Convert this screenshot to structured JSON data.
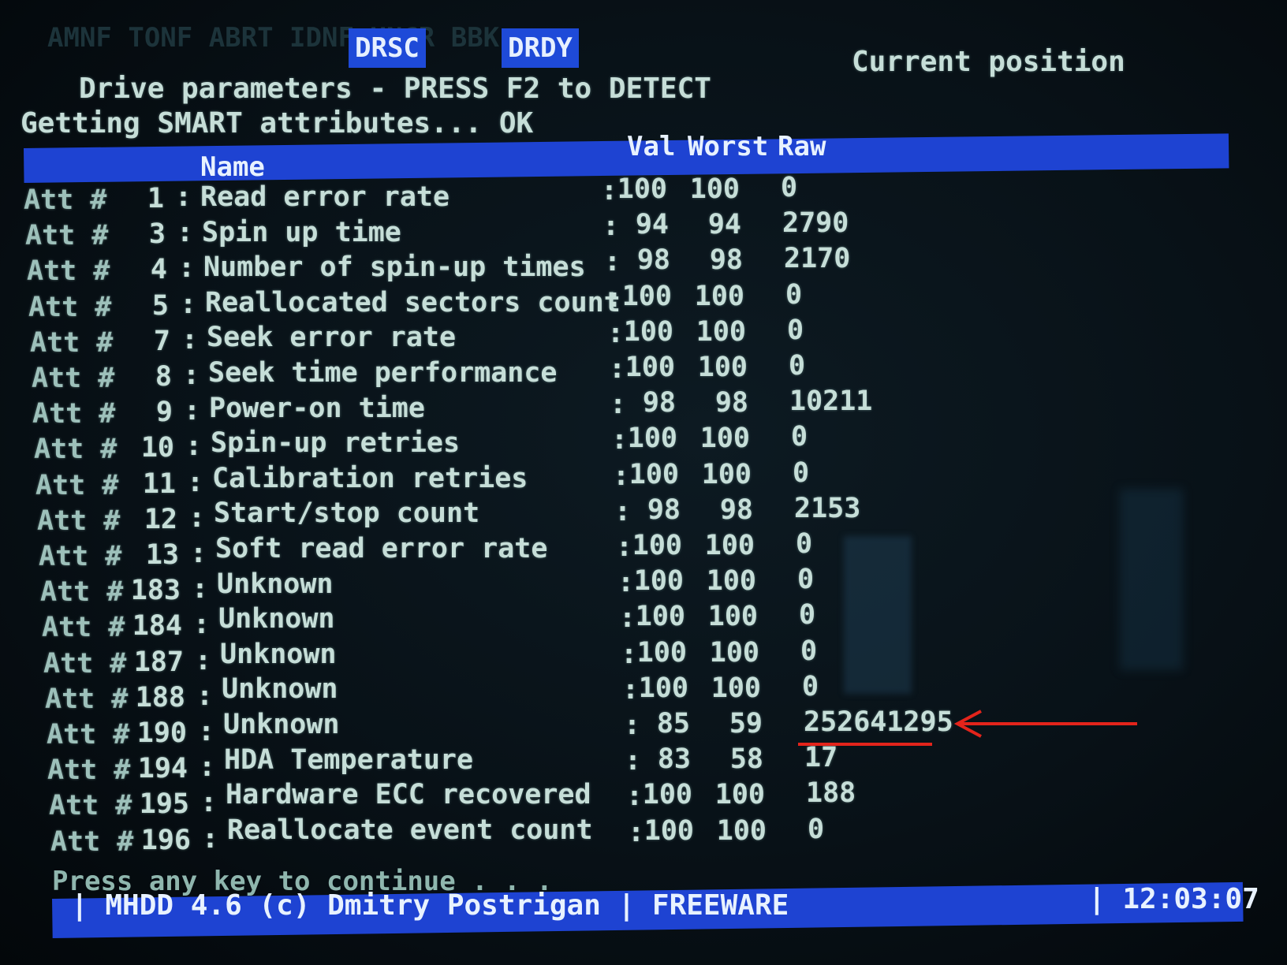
{
  "status_flags_top": "AMNF TONF ABRT IDNF UNCR BBK",
  "status_flags": [
    "DRSC",
    "DRDY"
  ],
  "current_position_label": "Current position",
  "drive_params_line": "Drive parameters - PRESS F2 to DETECT",
  "getting_smart_line": "Getting SMART attributes... OK",
  "table_header": {
    "name": "Name",
    "val": "Val",
    "worst": "Worst",
    "raw": "Raw"
  },
  "attributes": [
    {
      "label": "Att #",
      "num": "1",
      "name": "Read error rate",
      "val": "100",
      "worst": "100",
      "raw": "0"
    },
    {
      "label": "Att #",
      "num": "3",
      "name": "Spin up time",
      "val": "94",
      "worst": "94",
      "raw": "2790"
    },
    {
      "label": "Att #",
      "num": "4",
      "name": "Number of spin-up times",
      "val": "98",
      "worst": "98",
      "raw": "2170"
    },
    {
      "label": "Att #",
      "num": "5",
      "name": "Reallocated sectors count",
      "val": "100",
      "worst": "100",
      "raw": "0"
    },
    {
      "label": "Att #",
      "num": "7",
      "name": "Seek error rate",
      "val": "100",
      "worst": "100",
      "raw": "0"
    },
    {
      "label": "Att #",
      "num": "8",
      "name": "Seek time performance",
      "val": "100",
      "worst": "100",
      "raw": "0"
    },
    {
      "label": "Att #",
      "num": "9",
      "name": "Power-on time",
      "val": "98",
      "worst": "98",
      "raw": "10211"
    },
    {
      "label": "Att #",
      "num": "10",
      "name": "Spin-up retries",
      "val": "100",
      "worst": "100",
      "raw": "0"
    },
    {
      "label": "Att #",
      "num": "11",
      "name": "Calibration retries",
      "val": "100",
      "worst": "100",
      "raw": "0"
    },
    {
      "label": "Att #",
      "num": "12",
      "name": "Start/stop count",
      "val": "98",
      "worst": "98",
      "raw": "2153"
    },
    {
      "label": "Att #",
      "num": "13",
      "name": "Soft read error rate",
      "val": "100",
      "worst": "100",
      "raw": "0"
    },
    {
      "label": "Att #",
      "num": "183",
      "name": "Unknown",
      "val": "100",
      "worst": "100",
      "raw": "0"
    },
    {
      "label": "Att #",
      "num": "184",
      "name": "Unknown",
      "val": "100",
      "worst": "100",
      "raw": "0"
    },
    {
      "label": "Att #",
      "num": "187",
      "name": "Unknown",
      "val": "100",
      "worst": "100",
      "raw": "0"
    },
    {
      "label": "Att #",
      "num": "188",
      "name": "Unknown",
      "val": "100",
      "worst": "100",
      "raw": "0"
    },
    {
      "label": "Att #",
      "num": "190",
      "name": "Unknown",
      "val": "85",
      "worst": "59",
      "raw": "252641295"
    },
    {
      "label": "Att #",
      "num": "194",
      "name": "HDA Temperature",
      "val": "83",
      "worst": "58",
      "raw": "17"
    },
    {
      "label": "Att #",
      "num": "195",
      "name": "Hardware ECC recovered",
      "val": "100",
      "worst": "100",
      "raw": "188"
    },
    {
      "label": "Att #",
      "num": "196",
      "name": "Reallocate event count",
      "val": "100",
      "worst": "100",
      "raw": "0"
    }
  ],
  "press_any_key": "Press any key to continue . . ._",
  "footer": {
    "text": "| MHDD 4.6 (c) Dmitry Postrigan | FREEWARE",
    "time": "| 12:03:07"
  },
  "colors": {
    "band": "#1e43d2",
    "text": "#c6ded8",
    "annotation": "#e3241b"
  }
}
